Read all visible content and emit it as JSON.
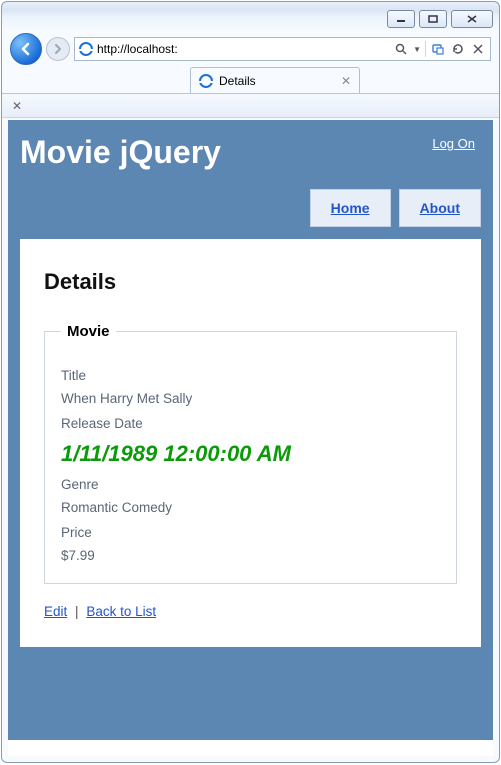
{
  "browser": {
    "url": "http://localhost:",
    "tab_title": "Details"
  },
  "header": {
    "site_title": "Movie jQuery",
    "logon": "Log On"
  },
  "menu": {
    "home": "Home",
    "about": "About"
  },
  "page": {
    "heading": "Details",
    "legend": "Movie",
    "labels": {
      "title": "Title",
      "release": "Release Date",
      "genre": "Genre",
      "price": "Price"
    },
    "values": {
      "title": "When Harry Met Sally",
      "release": "1/11/1989 12:00:00 AM",
      "genre": "Romantic Comedy",
      "price": "$7.99"
    },
    "actions": {
      "edit": "Edit",
      "back": "Back to List",
      "sep": "|"
    }
  }
}
